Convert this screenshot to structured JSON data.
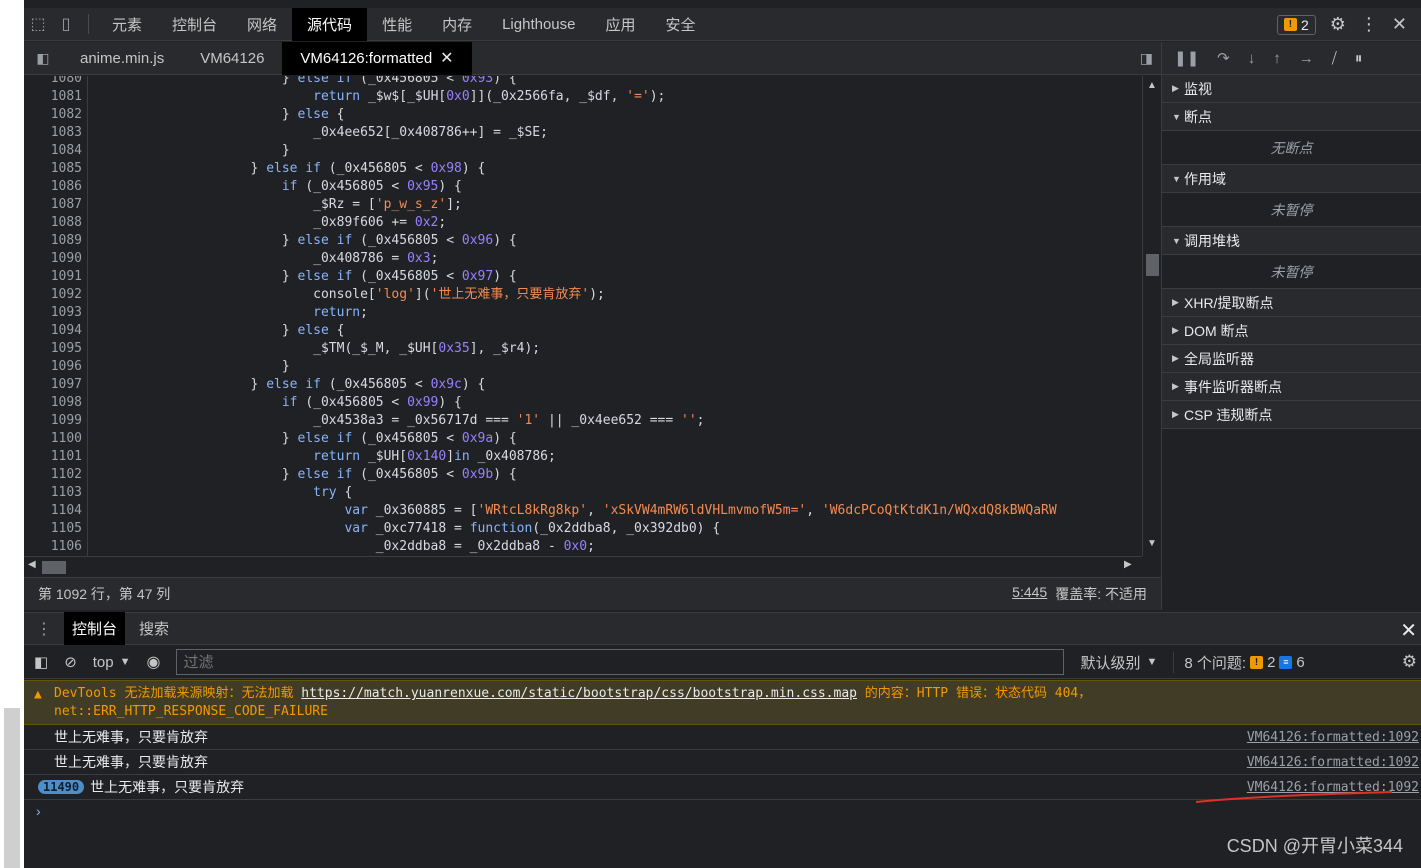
{
  "top_tabs": [
    "元素",
    "控制台",
    "网络",
    "源代码",
    "性能",
    "内存",
    "Lighthouse",
    "应用",
    "安全"
  ],
  "top_active": "源代码",
  "issue_count": "2",
  "file_tabs": [
    "anime.min.js",
    "VM64126",
    "VM64126:formatted"
  ],
  "code": [
    {
      "n": "1080",
      "html": "                        } <span class='c-kw'>else if</span> (_0x456805 &lt; <span class='c-num'>0x93</span>) {"
    },
    {
      "n": "1081",
      "html": "                            <span class='c-kw'>return</span> _$w$[_$UH[<span class='c-num'>0x0</span>]](_0x2566fa, _$df, <span class='c-str'>'='</span>);"
    },
    {
      "n": "1082",
      "html": "                        } <span class='c-kw'>else</span> {"
    },
    {
      "n": "1083",
      "html": "                            _0x4ee652[_0x408786++] = _$SE;"
    },
    {
      "n": "1084",
      "html": "                        }"
    },
    {
      "n": "1085",
      "html": "                    } <span class='c-kw'>else if</span> (_0x456805 &lt; <span class='c-num'>0x98</span>) {"
    },
    {
      "n": "1086",
      "html": "                        <span class='c-kw'>if</span> (_0x456805 &lt; <span class='c-num'>0x95</span>) {"
    },
    {
      "n": "1087",
      "html": "                            _$Rz = [<span class='c-str'>'p_w_s_z'</span>];"
    },
    {
      "n": "1088",
      "html": "                            _0x89f606 += <span class='c-num'>0x2</span>;"
    },
    {
      "n": "1089",
      "html": "                        } <span class='c-kw'>else if</span> (_0x456805 &lt; <span class='c-num'>0x96</span>) {"
    },
    {
      "n": "1090",
      "html": "                            _0x408786 = <span class='c-num'>0x3</span>;"
    },
    {
      "n": "1091",
      "html": "                        } <span class='c-kw'>else if</span> (_0x456805 &lt; <span class='c-num'>0x97</span>) {"
    },
    {
      "n": "1092",
      "html": "                            console[<span class='c-str'>'log'</span>](<span class='c-str'>'世上无难事，只要肯放弃'</span>);"
    },
    {
      "n": "1093",
      "html": "                            <span class='c-kw'>return</span>;"
    },
    {
      "n": "1094",
      "html": "                        } <span class='c-kw'>else</span> {"
    },
    {
      "n": "1095",
      "html": "                            _$TM(_$_M, _$UH[<span class='c-num'>0x35</span>], _$r4);"
    },
    {
      "n": "1096",
      "html": "                        }"
    },
    {
      "n": "1097",
      "html": "                    } <span class='c-kw'>else if</span> (_0x456805 &lt; <span class='c-num'>0x9c</span>) {"
    },
    {
      "n": "1098",
      "html": "                        <span class='c-kw'>if</span> (_0x456805 &lt; <span class='c-num'>0x99</span>) {"
    },
    {
      "n": "1099",
      "html": "                            _0x4538a3 = _0x56717d === <span class='c-str'>'1'</span> || _0x4ee652 === <span class='c-str'>''</span>;"
    },
    {
      "n": "1100",
      "html": "                        } <span class='c-kw'>else if</span> (_0x456805 &lt; <span class='c-num'>0x9a</span>) {"
    },
    {
      "n": "1101",
      "html": "                            <span class='c-kw'>return</span> _$UH[<span class='c-num'>0x140</span>]<span class='c-kw'>in</span> _0x408786;"
    },
    {
      "n": "1102",
      "html": "                        } <span class='c-kw'>else if</span> (_0x456805 &lt; <span class='c-num'>0x9b</span>) {"
    },
    {
      "n": "1103",
      "html": "                            <span class='c-kw'>try</span> {"
    },
    {
      "n": "1104",
      "html": "                                <span class='c-kw'>var</span> _0x360885 = [<span class='c-str'>'WRtcL8kRg8kp'</span>, <span class='c-str'>'xSkVW4mRW6ldVHLmvmofW5m='</span>, <span class='c-str'>'W6dcPCoQtKtdK1n/WQxdQ8kBWQaRW</span>"
    },
    {
      "n": "1105",
      "html": "                                <span class='c-kw'>var</span> _0xc77418 = <span class='c-kw'>function</span>(_0x2ddba8, _0x392db0) {"
    },
    {
      "n": "1106",
      "html": "                                    _0x2ddba8 = _0x2ddba8 - <span class='c-num'>0x0</span>;"
    }
  ],
  "status": {
    "position": "第 1092 行，第 47 列",
    "chars": "5:445",
    "coverage": "覆盖率: 不适用"
  },
  "sidebar": {
    "panes": [
      {
        "title": "监视",
        "open": false
      },
      {
        "title": "断点",
        "open": true,
        "body": "无断点"
      },
      {
        "title": "作用域",
        "open": true,
        "body": "未暂停"
      },
      {
        "title": "调用堆栈",
        "open": true,
        "body": "未暂停"
      },
      {
        "title": "XHR/提取断点",
        "open": false
      },
      {
        "title": "DOM 断点",
        "open": false
      },
      {
        "title": "全局监听器",
        "open": false
      },
      {
        "title": "事件监听器断点",
        "open": false
      },
      {
        "title": "CSP 违规断点",
        "open": false
      }
    ]
  },
  "drawer": {
    "tabs": [
      "控制台",
      "搜索"
    ],
    "context": "top",
    "filter_placeholder": "过滤",
    "level": "默认级别",
    "issues_label": "8 个问题:",
    "warn_count": "2",
    "info_count": "6"
  },
  "console": {
    "warning_pre": "DevTools 无法加载来源映射：无法加载 ",
    "warning_url": "https://match.yuanrenxue.com/static/bootstrap/css/bootstrap.min.css.map",
    "warning_post": " 的内容：HTTP 错误：状态代码 404，",
    "warning_line2": "net::ERR_HTTP_RESPONSE_CODE_FAILURE",
    "logs": [
      {
        "count": "",
        "text": "世上无难事，只要肯放弃",
        "src": "VM64126:formatted:1092"
      },
      {
        "count": "",
        "text": "世上无难事，只要肯放弃",
        "src": "VM64126:formatted:1092"
      },
      {
        "count": "11490",
        "text": "世上无难事，只要肯放弃",
        "src": "VM64126:formatted:1092"
      }
    ]
  },
  "watermark": "CSDN @开胃小菜344"
}
